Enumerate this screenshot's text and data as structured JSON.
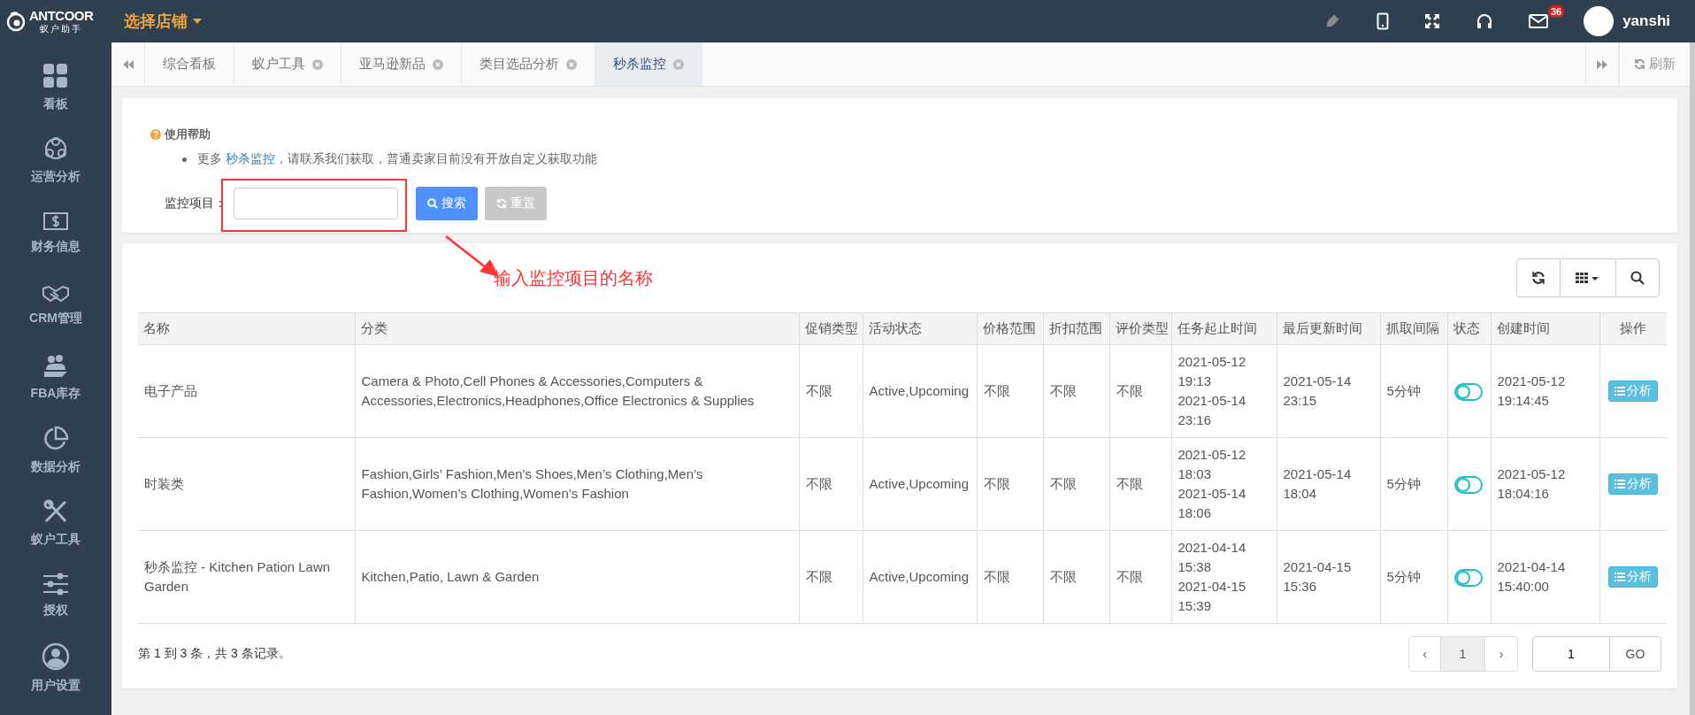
{
  "topbar": {
    "logo": "ANTCOOR",
    "logo_subtitle": "蚁户助手",
    "store_selector": "选择店铺",
    "mail_badge": "36",
    "user": "yanshi"
  },
  "sidebar": {
    "items": [
      {
        "label": "看板"
      },
      {
        "label": "运营分析"
      },
      {
        "label": "财务信息"
      },
      {
        "label": "CRM管理"
      },
      {
        "label": "FBA库存"
      },
      {
        "label": "数据分析"
      },
      {
        "label": "蚁户工具"
      },
      {
        "label": "授权"
      },
      {
        "label": "用户设置"
      }
    ]
  },
  "tabs": [
    {
      "label": "综合看板",
      "closable": false,
      "selected": false
    },
    {
      "label": "蚁户工具",
      "closable": true,
      "selected": false
    },
    {
      "label": "亚马逊新品",
      "closable": true,
      "selected": false
    },
    {
      "label": "类目选品分析",
      "closable": true,
      "selected": false
    },
    {
      "label": "秒杀监控",
      "closable": true,
      "selected": true
    }
  ],
  "refresh": "刷新",
  "help": {
    "title": "使用帮助",
    "before": "更多 ",
    "link": "秒杀监控",
    "after": "，请联系我们获取，普通卖家目前没有开放自定义获取功能"
  },
  "search": {
    "label": "监控项目：",
    "buttons": [
      {
        "label": "搜索",
        "disabled": false
      },
      {
        "label": "重置",
        "disabled": true
      }
    ]
  },
  "annotation": "输入监控项目的名称",
  "table": {
    "columns": [
      "名称",
      "分类",
      "促销类型",
      "活动状态",
      "价格范围",
      "折扣范围",
      "评价类型",
      "任务起止时间",
      "最后更新时间",
      "抓取间隔",
      "状态",
      "创建时间",
      "操作"
    ],
    "rows": [
      {
        "name": "电子产品",
        "category": "Camera & Photo,Cell Phones & Accessories,Computers & Accessories,Electronics,Headphones,Office Electronics & Supplies",
        "promo_type": "不限",
        "activity_status": "Active,Upcoming",
        "price_range": "不限",
        "discount_range": "不限",
        "review_type": "不限",
        "task_start": "2021-05-12 19:13",
        "task_end": "2021-05-14 23:16",
        "last_update": "2021-05-14 23:15",
        "interval": "5分钟",
        "on": false,
        "created": "2021-05-12 19:14:45",
        "action": "分析"
      },
      {
        "name": "时装类",
        "category": "Fashion,Girls’ Fashion,Men's Shoes,Men’s Clothing,Men’s Fashion,Women’s Clothing,Women’s Fashion",
        "promo_type": "不限",
        "activity_status": "Active,Upcoming",
        "price_range": "不限",
        "discount_range": "不限",
        "review_type": "不限",
        "task_start": "2021-05-12 18:03",
        "task_end": "2021-05-14 18:06",
        "last_update": "2021-05-14 18:04",
        "interval": "5分钟",
        "on": false,
        "created": "2021-05-12 18:04:16",
        "action": "分析"
      },
      {
        "name": "秒杀监控 - Kitchen Pation Lawn Garden",
        "category": "Kitchen,Patio, Lawn & Garden",
        "promo_type": "不限",
        "activity_status": "Active,Upcoming",
        "price_range": "不限",
        "discount_range": "不限",
        "review_type": "不限",
        "task_start": "2021-04-14 15:38",
        "task_end": "2021-04-15 15:39",
        "last_update": "2021-04-15 15:36",
        "interval": "5分钟",
        "on": false,
        "created": "2021-04-14 15:40:00",
        "action": "分析"
      }
    ]
  },
  "footer": {
    "summary": "第 1 到 3 条，共 3 条记录。",
    "prev": "‹",
    "pages": [
      {
        "label": "1",
        "selected": true
      }
    ],
    "next": "›",
    "goto_value": "1",
    "go": "GO"
  }
}
